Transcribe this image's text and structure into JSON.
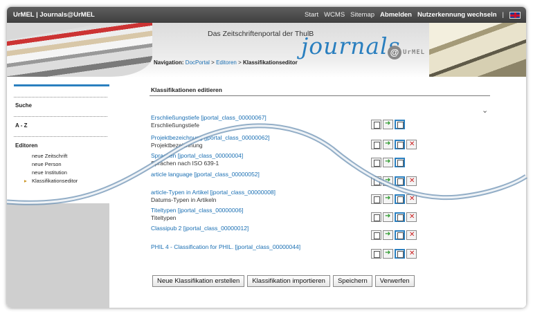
{
  "topbar": {
    "brand": "UrMEL | Journals@UrMEL",
    "nav": [
      {
        "label": "Start",
        "bold": false
      },
      {
        "label": "WCMS",
        "bold": false
      },
      {
        "label": "Sitemap",
        "bold": false
      },
      {
        "label": "Abmelden",
        "bold": true
      },
      {
        "label": "Nutzerkennung wechseln",
        "bold": true
      }
    ],
    "separator": "|",
    "language_flag": "uk-flag-icon"
  },
  "header": {
    "portal_title": "Das Zeitschriftenportal der ThulB",
    "logo_text": "journals",
    "logo_at": "@",
    "logo_sub": "UrMEL"
  },
  "breadcrumb": {
    "label": "Navigation:",
    "items": [
      "DocPortal",
      "Editoren",
      "Klassifikationseditor"
    ],
    "separator": ">"
  },
  "sidebar": {
    "items": [
      {
        "label": "Suche"
      },
      {
        "label": "A - Z"
      },
      {
        "label": "Editoren"
      }
    ],
    "sub_items": [
      {
        "label": "neue Zeitschrift",
        "active": false
      },
      {
        "label": "neue Person",
        "active": false
      },
      {
        "label": "neue Institution",
        "active": false
      },
      {
        "label": "Klassifikationseditor",
        "active": true
      }
    ]
  },
  "main": {
    "title": "Klassifikationen editieren",
    "collapse_icon": "chevron-down-icon",
    "classifications": [
      {
        "link": "Erschließungstiefe [jportal_class_00000067]",
        "desc": "Erschließungstiefe",
        "deletable": false
      },
      {
        "link": "Projektbezeichnung [jportal_class_00000062]",
        "desc": "Projektbezeichnung",
        "deletable": true
      },
      {
        "link": "Sprachen [jportal_class_00000004]",
        "desc": "Sprachen nach ISO 639-1",
        "deletable": false
      },
      {
        "link": "article language [jportal_class_00000052]",
        "desc": "",
        "deletable": true
      },
      {
        "link": "article-Typen in Artikel [jportal_class_00000008]",
        "desc": "Datums-Typen in Artikeln",
        "deletable": true
      },
      {
        "link": "Titeltypen [jportal_class_00000006]",
        "desc": "Titeltypen",
        "deletable": true
      },
      {
        "link": "Classipub 2 [jportal_class_00000012]",
        "desc": "",
        "deletable": true
      },
      {
        "link": "PHIL 4 - Classification for PHIL. [jportal_class_00000044]",
        "desc": "",
        "deletable": true
      }
    ],
    "buttons": {
      "create": "Neue Klassifikation erstellen",
      "import": "Klassifikation importieren",
      "save": "Speichern",
      "discard": "Verwerfen"
    }
  },
  "colors": {
    "accent": "#2a7fbf",
    "topbar": "#4a4a4a",
    "link": "#1a6fb3",
    "delete": "#cc1d1d"
  }
}
